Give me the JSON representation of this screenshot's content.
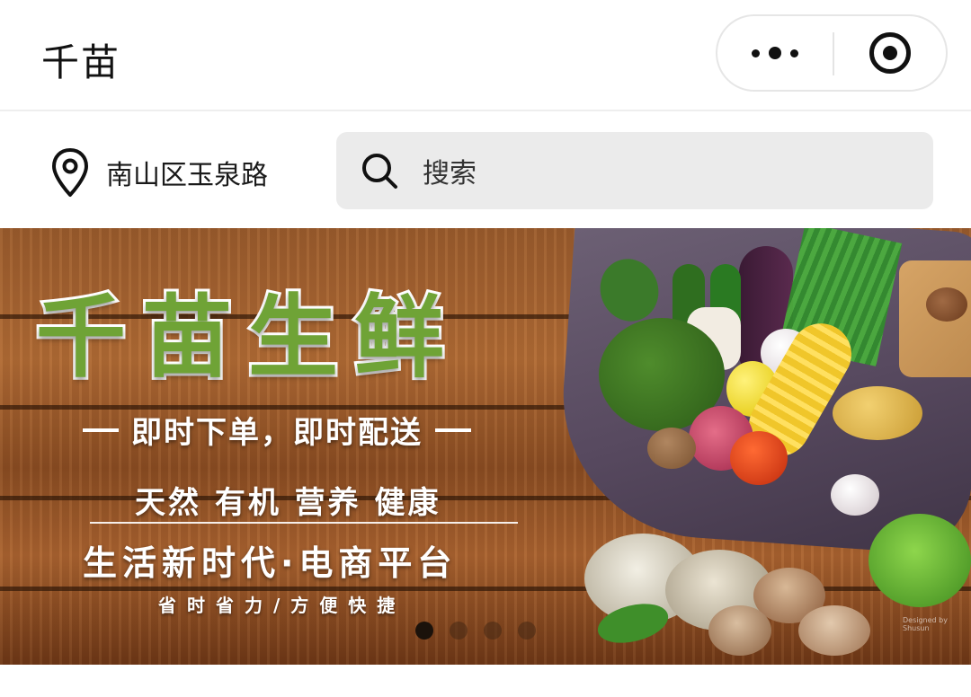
{
  "header": {
    "title": "千苗",
    "capsule": {
      "more_icon": "more-dots-icon",
      "close_icon": "target-ring-icon"
    }
  },
  "location": {
    "icon": "location-pin-icon",
    "text": "南山区玉泉路"
  },
  "search": {
    "icon": "search-icon",
    "placeholder": "搜索"
  },
  "banner": {
    "title": "千苗生鲜",
    "tagline": "即时下单，即时配送",
    "line1": "天然 有机 营养 健康",
    "line2": "生活新时代·电商平台",
    "line3": "省时省力/方便快捷",
    "watermark": "Designed by Shusun",
    "carousel": {
      "count": 4,
      "active_index": 0
    }
  },
  "colors": {
    "title_green": "#6fa336",
    "search_bg": "#ebebeb",
    "wood": "#9a5b2c"
  }
}
